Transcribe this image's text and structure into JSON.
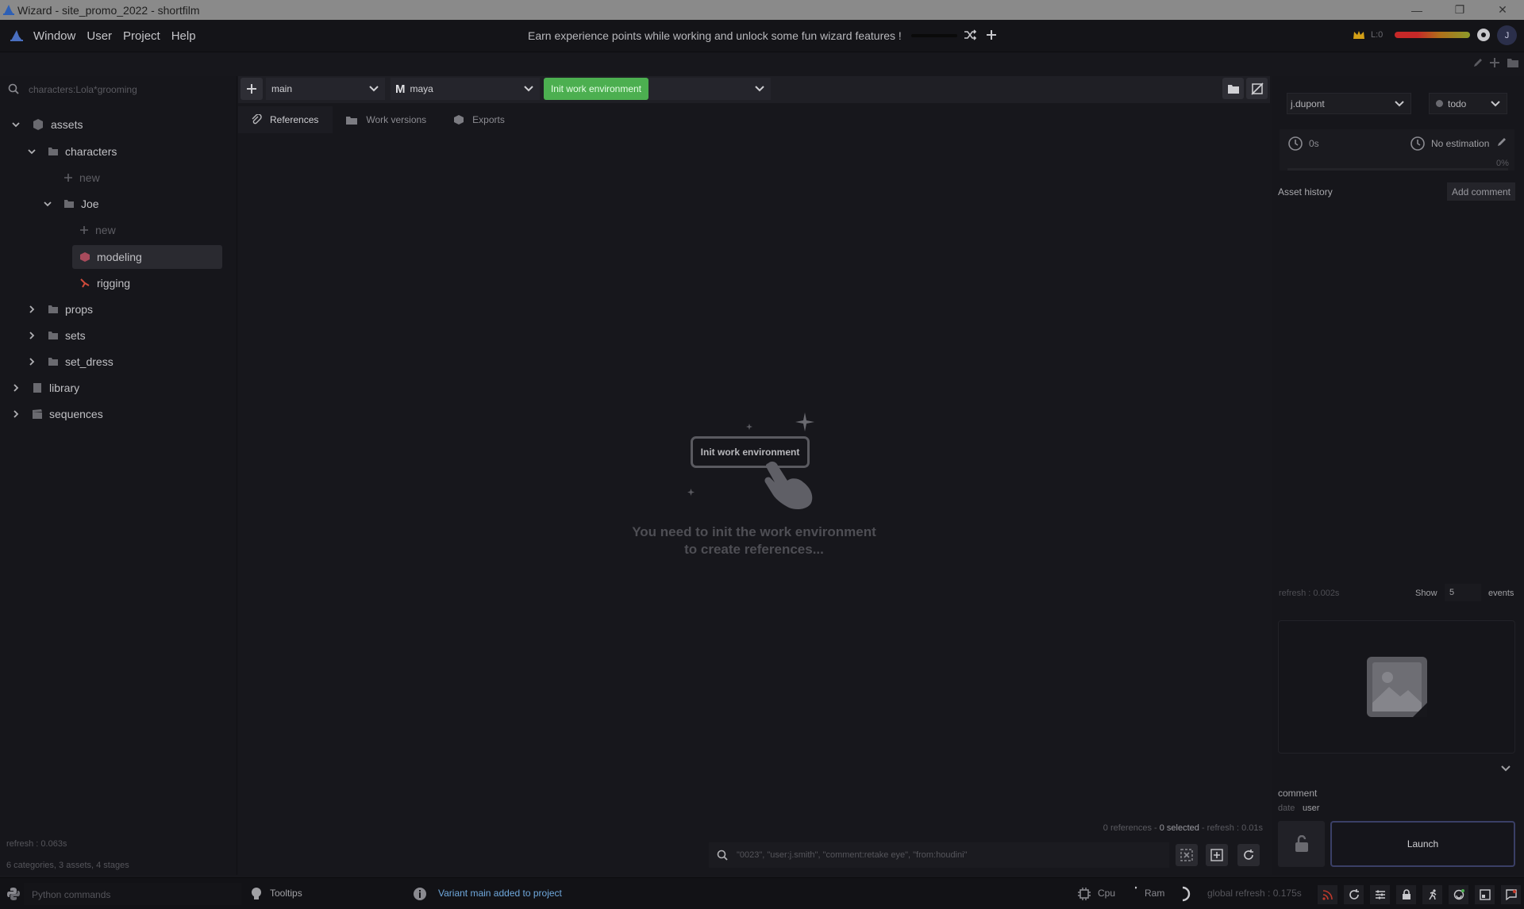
{
  "window": {
    "title": "Wizard - site_promo_2022 - shortfilm",
    "controls": [
      "—",
      "❐",
      "✕"
    ]
  },
  "menu": {
    "items": [
      "Window",
      "User",
      "Project",
      "Help"
    ],
    "banner": "Earn experience points while working and unlock some fun wizard features !",
    "level": "L:0",
    "avatar_initial": "J"
  },
  "left": {
    "search_placeholder": "characters:Lola*grooming",
    "tree": {
      "assets": "assets",
      "characters": "characters",
      "new1": "new",
      "joe": "Joe",
      "new2": "new",
      "modeling": "modeling",
      "rigging": "rigging",
      "props": "props",
      "sets": "sets",
      "set_dress": "set_dress",
      "library": "library",
      "sequences": "sequences"
    },
    "refresh": "refresh : 0.063s",
    "summary": "6 categories, 3 assets, 4 stages"
  },
  "toolbar": {
    "variant": "main",
    "software": "maya",
    "init_button": "Init work environment"
  },
  "tabs": [
    "References",
    "Work versions",
    "Exports"
  ],
  "empty_state": {
    "illustration_button": "Init work environment",
    "line1": "You need to init the work environment",
    "line2": "to create references..."
  },
  "references_status": {
    "count": "0 references",
    "selected": "0 selected",
    "refresh": "refresh : 0.01s",
    "sep": " - "
  },
  "filter_placeholder": "\"0023\", \"user:j.smith\", \"comment:retake eye\", \"from:houdini\"",
  "right": {
    "user": "j.dupont",
    "state": "todo",
    "time_spent": "0s",
    "estimation": "No estimation",
    "progress": "0%",
    "progress_value": 0,
    "history_title": "Asset history",
    "add_comment": "Add comment",
    "refresh": "refresh : 0.002s",
    "show_label": "Show",
    "show_count": "5",
    "events_label": "events",
    "comment_label": "comment",
    "date_label": "date",
    "user_label": "user",
    "launch": "Launch"
  },
  "status": {
    "python_placeholder": "Python commands",
    "tooltips": "Tooltips",
    "message": "Variant main added to project",
    "cpu": "Cpu",
    "ram": "Ram",
    "global_refresh": "global refresh : 0.175s"
  },
  "colors": {
    "accent_green": "#4caf50",
    "message_blue": "#6fa8dc",
    "launch_border": "#3a3f66"
  }
}
